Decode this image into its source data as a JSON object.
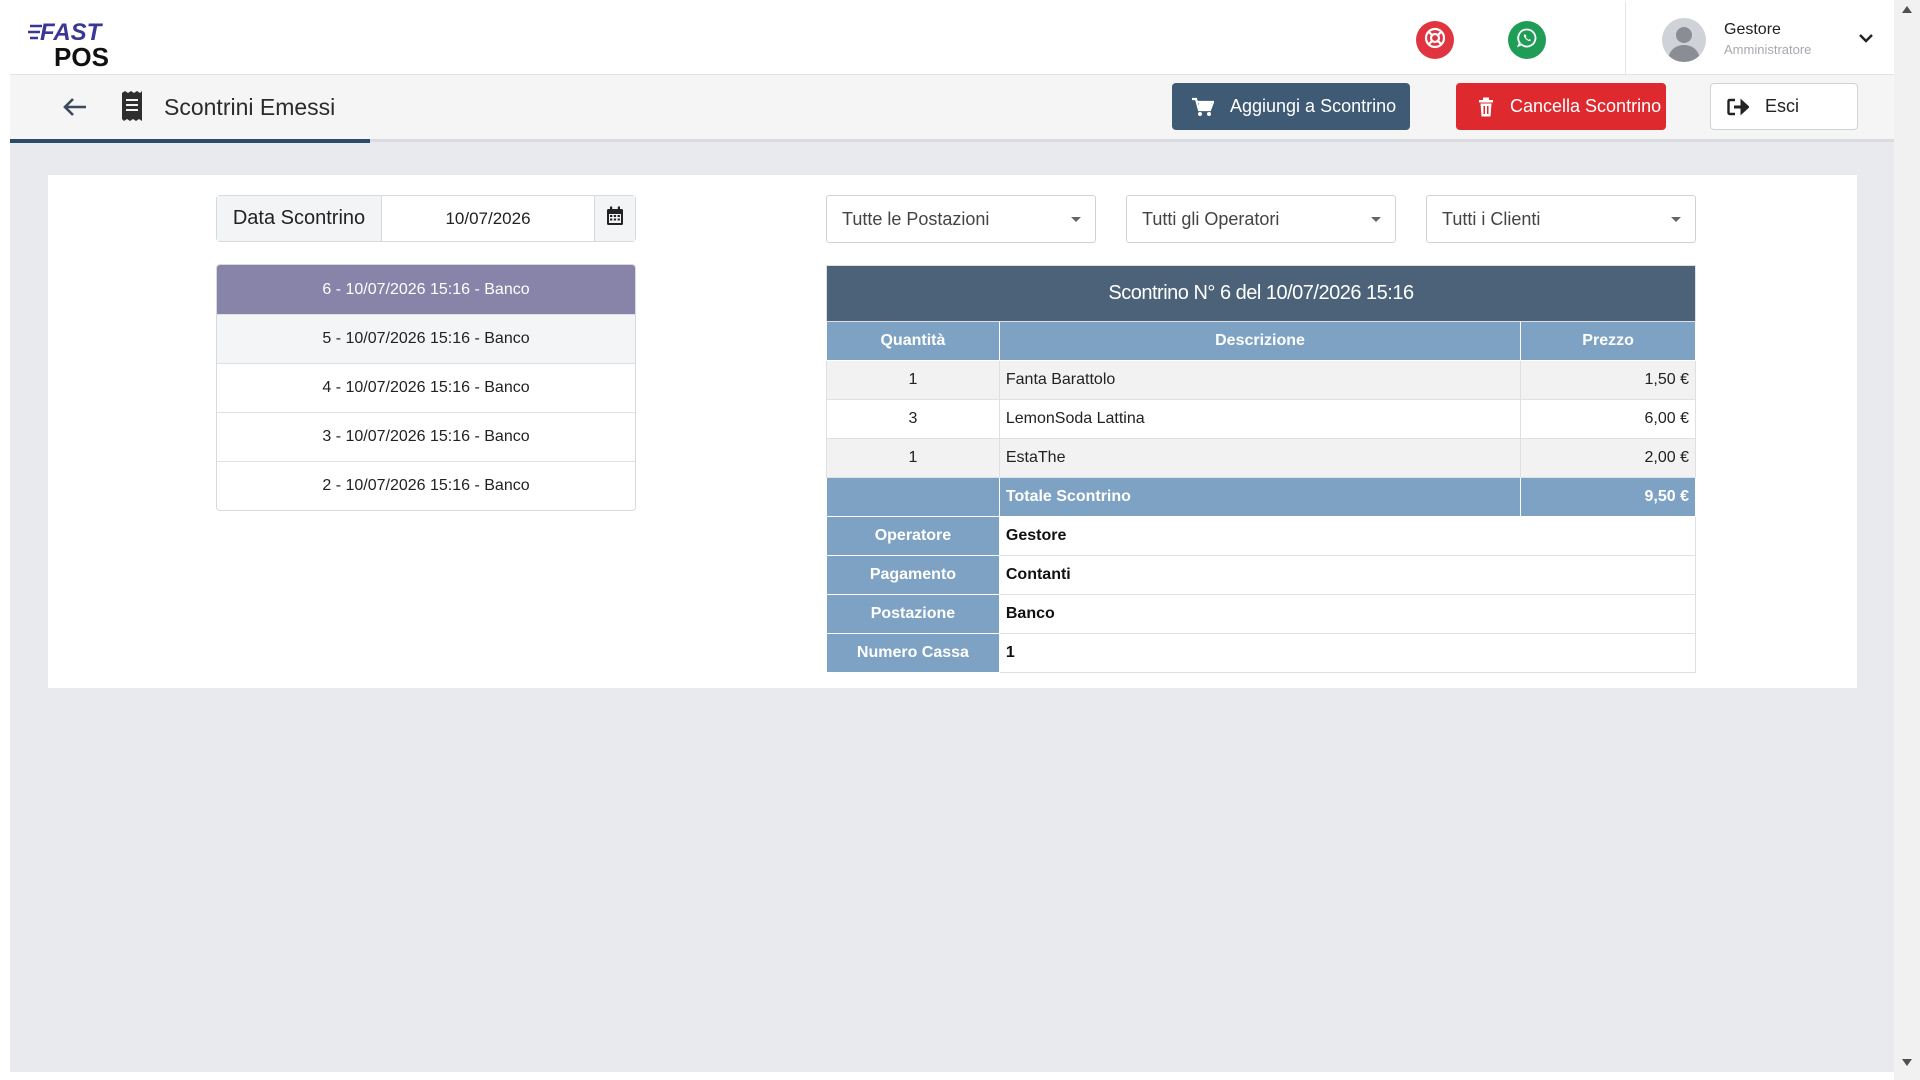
{
  "header": {
    "logo_top": "FAST",
    "logo_bottom": "POS",
    "user": {
      "name": "Gestore",
      "role": "Amministratore"
    },
    "icons": [
      "lifebuoy-icon",
      "whatsapp-icon",
      "avatar",
      "chevron-down-icon"
    ],
    "colors": {
      "help": "#e03540",
      "whatsapp": "#1f9d56"
    }
  },
  "toolbar": {
    "title": "Scontrini Emessi",
    "add_label": "Aggiungi a Scontrino",
    "delete_label": "Cancella Scontrino",
    "exit_label": "Esci",
    "colors": {
      "add": "#3e5a74",
      "delete": "#de2a2f",
      "accent": "#2d4a66"
    }
  },
  "filters": {
    "date_label": "Data Scontrino",
    "date_value": "10/07/2026",
    "postazioni": "Tutte le Postazioni",
    "operatori": "Tutti gli Operatori",
    "clienti": "Tutti i Clienti"
  },
  "receipts": [
    {
      "label": "6 - 10/07/2026 15:16 - Banco",
      "selected": true
    },
    {
      "label": "5 - 10/07/2026 15:16 - Banco",
      "selected": false
    },
    {
      "label": "4 - 10/07/2026 15:16 - Banco",
      "selected": false
    },
    {
      "label": "3 - 10/07/2026 15:16 - Banco",
      "selected": false
    },
    {
      "label": "2 - 10/07/2026 15:16 - Banco",
      "selected": false
    }
  ],
  "detail": {
    "title": "Scontrino N° 6 del 10/07/2026 15:16",
    "columns": [
      "Quantità",
      "Descrizione",
      "Prezzo"
    ],
    "items": [
      {
        "qty": "1",
        "desc": "Fanta Barattolo",
        "price": "1,50 €"
      },
      {
        "qty": "3",
        "desc": "LemonSoda Lattina",
        "price": "6,00 €"
      },
      {
        "qty": "1",
        "desc": "EstaThe",
        "price": "2,00 €"
      }
    ],
    "total_label": "Totale Scontrino",
    "total_value": "9,50 €",
    "info": [
      {
        "label": "Operatore",
        "value": "Gestore"
      },
      {
        "label": "Pagamento",
        "value": "Contanti"
      },
      {
        "label": "Postazione",
        "value": "Banco"
      },
      {
        "label": "Numero Cassa",
        "value": "1"
      }
    ]
  }
}
